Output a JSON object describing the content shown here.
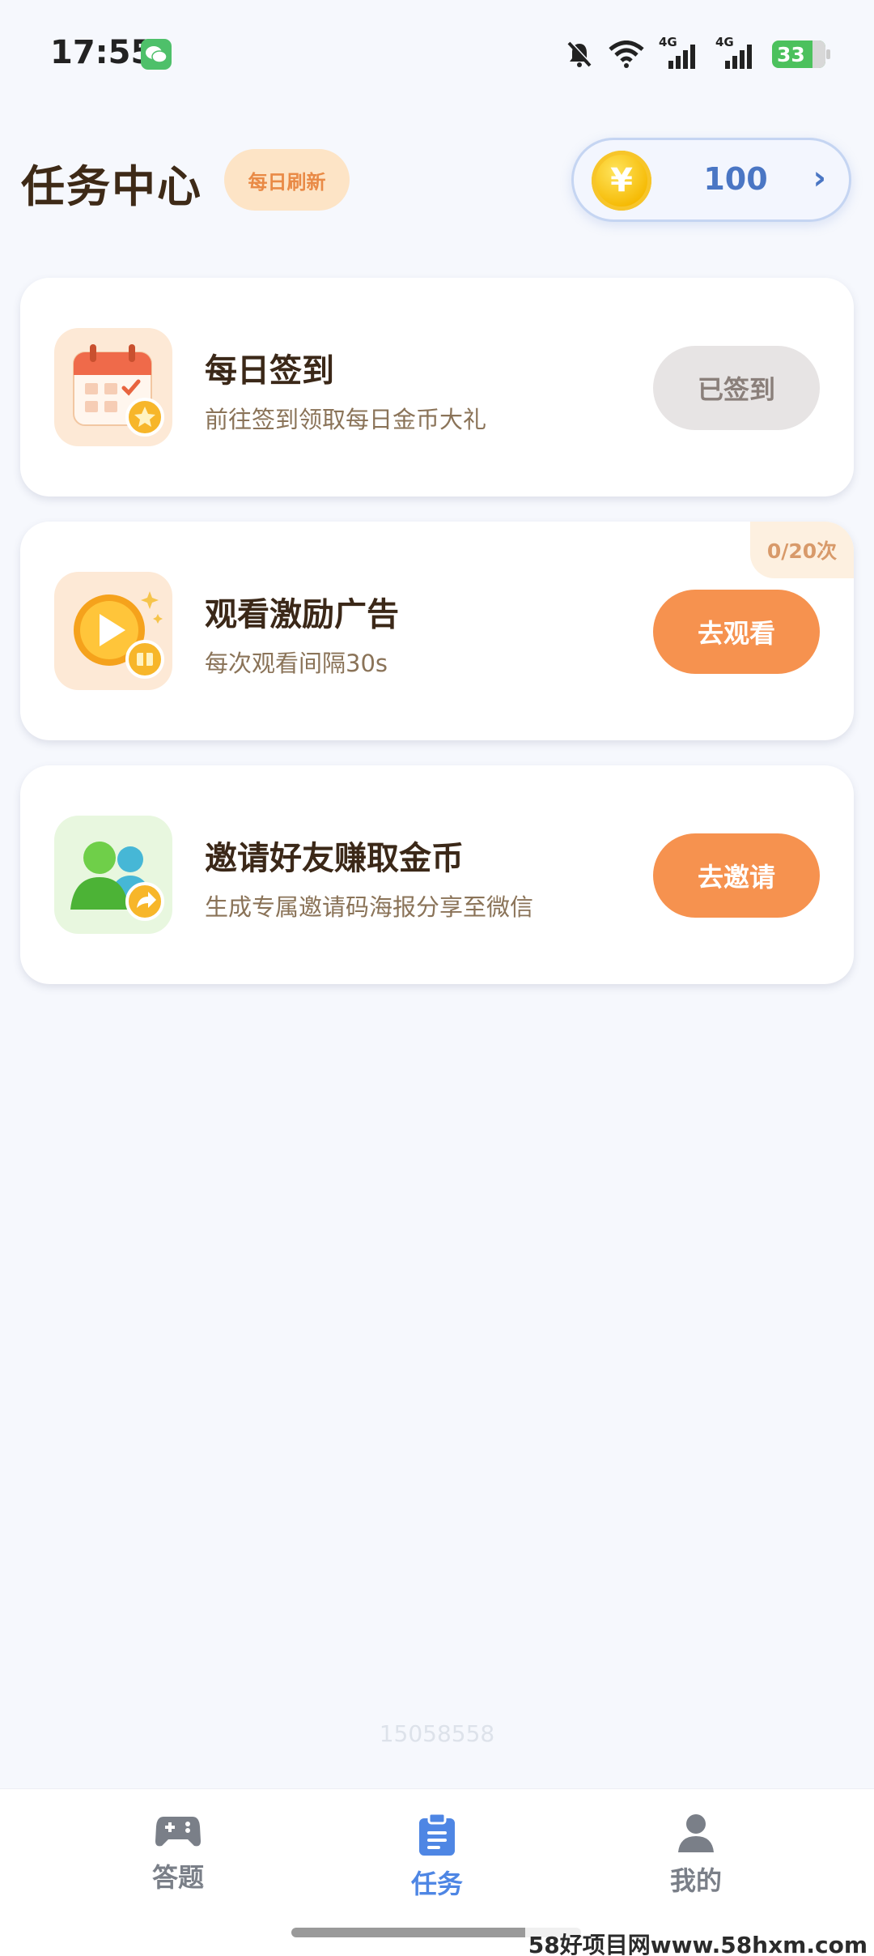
{
  "status_bar": {
    "time": "17:55",
    "network_1": "4G",
    "network_2": "4G",
    "battery": "33"
  },
  "header": {
    "title": "任务中心",
    "refresh_badge": "每日刷新",
    "coin_symbol": "¥",
    "coin_value": "100",
    "coin_arrow": "›"
  },
  "tasks": [
    {
      "title": "每日签到",
      "subtitle": "前往签到领取每日金币大礼",
      "button": "已签到",
      "icon": "calendar-icon"
    },
    {
      "title": "观看激励广告",
      "subtitle": "每次观看间隔30s",
      "button": "去观看",
      "count": "0/20次",
      "icon": "play-video-icon"
    },
    {
      "title": "邀请好友赚取金币",
      "subtitle": "生成专属邀请码海报分享至微信",
      "button": "去邀请",
      "icon": "invite-friends-icon"
    }
  ],
  "watermark": "15058558",
  "bottom_nav": {
    "items": [
      {
        "label": "答题",
        "icon": "gamepad-icon"
      },
      {
        "label": "任务",
        "icon": "clipboard-icon",
        "active": true
      },
      {
        "label": "我的",
        "icon": "user-icon"
      }
    ]
  },
  "site_mark": "58好项目网www.58hxm.com",
  "colors": {
    "accent_orange": "#f6924f",
    "active_blue": "#4e86e4",
    "done_grey": "#e7e4e4",
    "background": "#f6f8fd"
  }
}
